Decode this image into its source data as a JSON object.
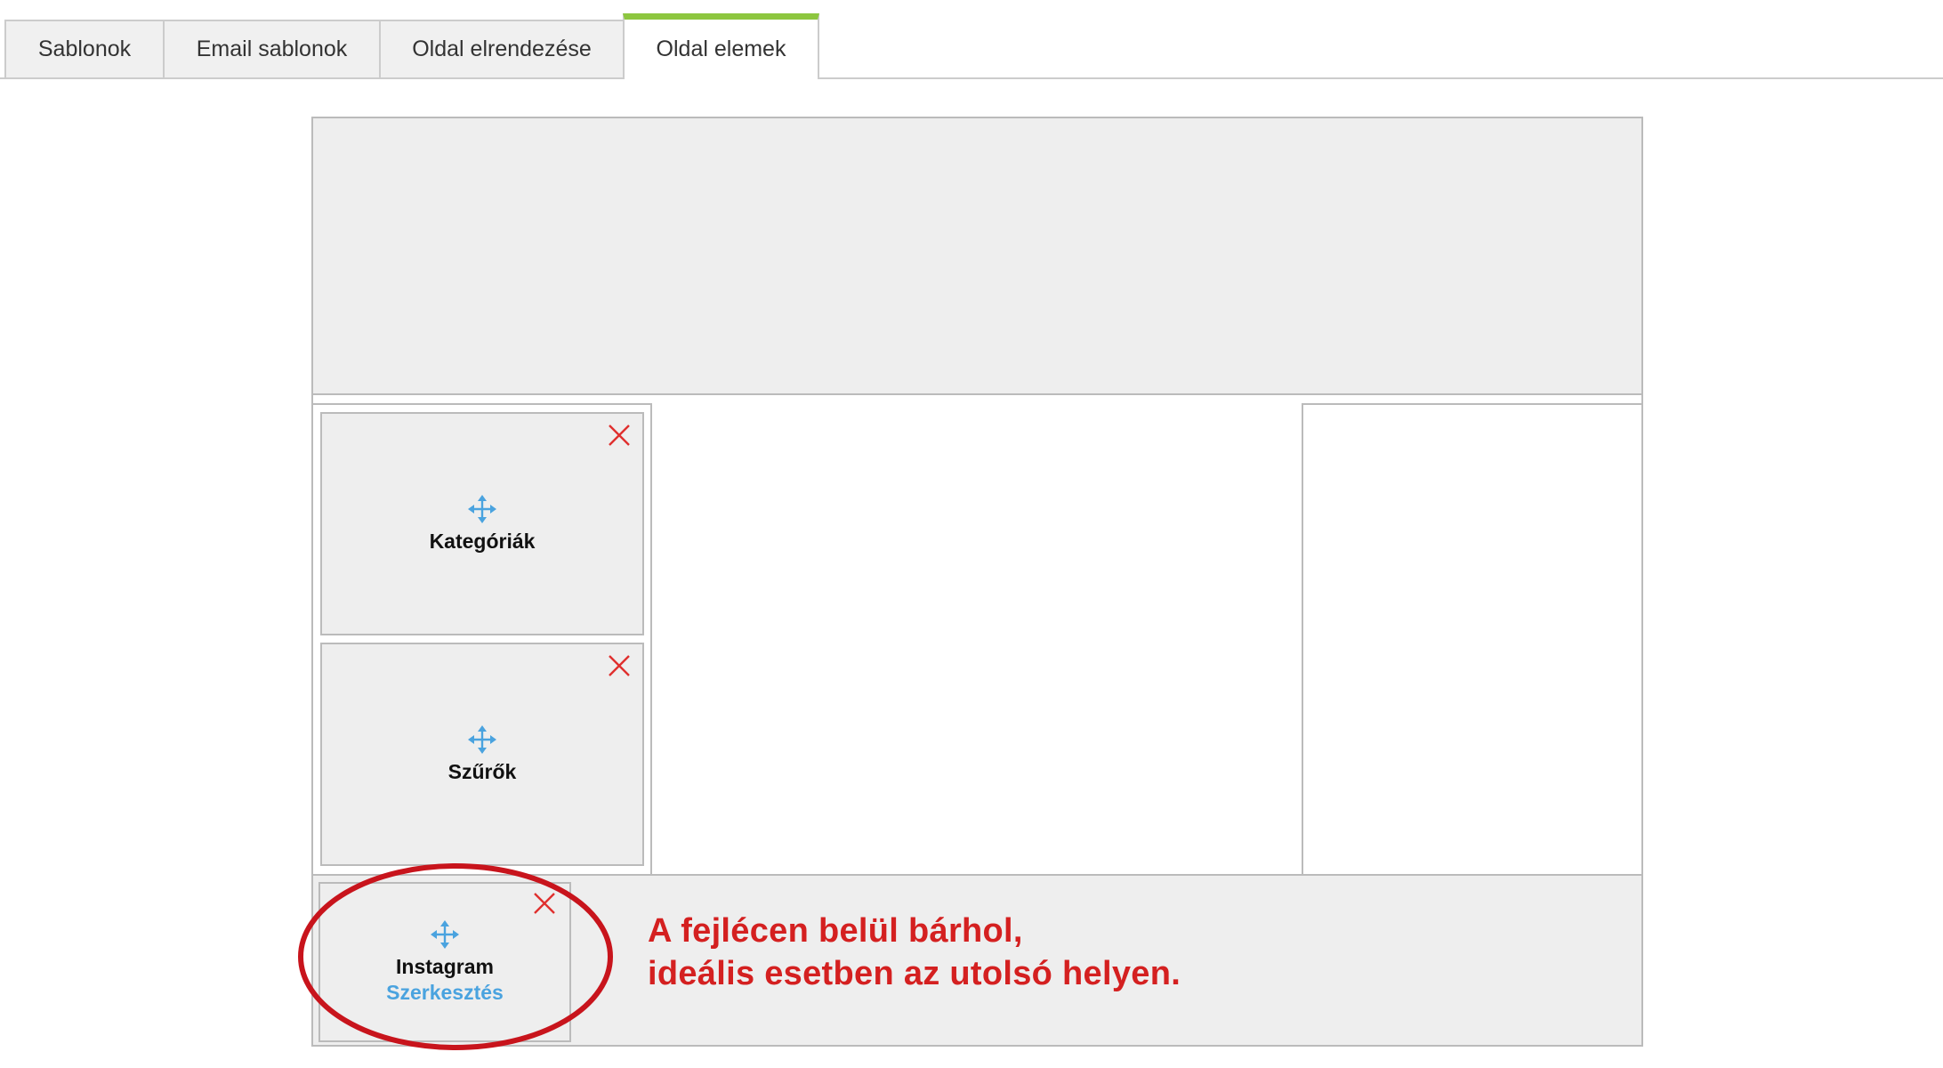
{
  "tabs": [
    {
      "label": "Sablonok",
      "active": false
    },
    {
      "label": "Email sablonok",
      "active": false
    },
    {
      "label": "Oldal elrendezése",
      "active": false
    },
    {
      "label": "Oldal elemek",
      "active": true
    }
  ],
  "widgets": {
    "kategoriak": {
      "title": "Kategóriák"
    },
    "szurok": {
      "title": "Szűrők"
    },
    "instagram": {
      "title": "Instagram",
      "edit_label": "Szerkesztés"
    }
  },
  "annotation": {
    "line1": "A fejlécen belül bárhol,",
    "line2": "ideális esetben az utolsó helyen."
  },
  "colors": {
    "tab_active_accent": "#8dc63f",
    "move_icon": "#4aa3df",
    "close_icon": "#e0302e",
    "annotation": "#d42020"
  },
  "icons": {
    "move": "move-arrows-icon",
    "close": "close-x-icon"
  }
}
